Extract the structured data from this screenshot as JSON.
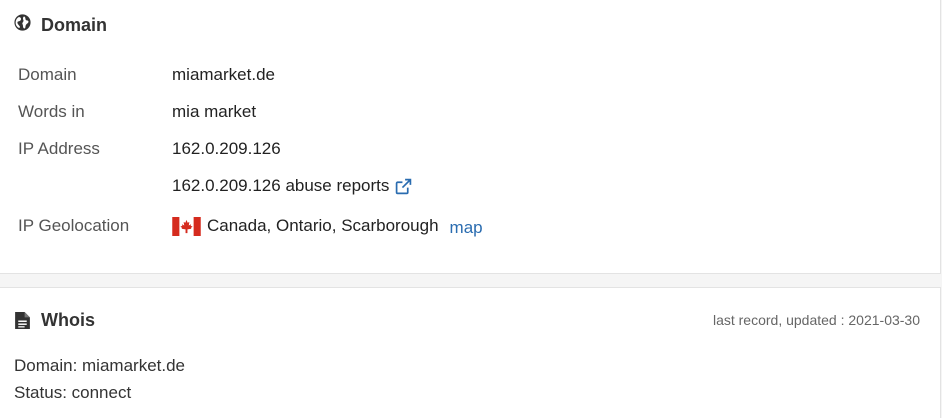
{
  "domain_section": {
    "title": "Domain",
    "icon": "globe-icon",
    "rows": {
      "domain": {
        "label": "Domain",
        "value": "miamarket.de"
      },
      "words": {
        "label": "Words in",
        "value": "mia market"
      },
      "ip": {
        "label": "IP Address",
        "value": "162.0.209.126"
      },
      "abuse": {
        "value": "162.0.209.126 abuse reports"
      },
      "geo": {
        "label": "IP Geolocation",
        "value": "Canada, Ontario, Scarborough",
        "map_link": "map",
        "flag": "canada-flag-icon"
      }
    }
  },
  "whois_section": {
    "title": "Whois",
    "icon": "document-icon",
    "updated": "last record, updated : 2021-03-30",
    "lines": [
      "Domain: miamarket.de",
      "Status: connect"
    ]
  },
  "colors": {
    "link": "#2a6cb0",
    "flag_red": "#d52b1e"
  }
}
